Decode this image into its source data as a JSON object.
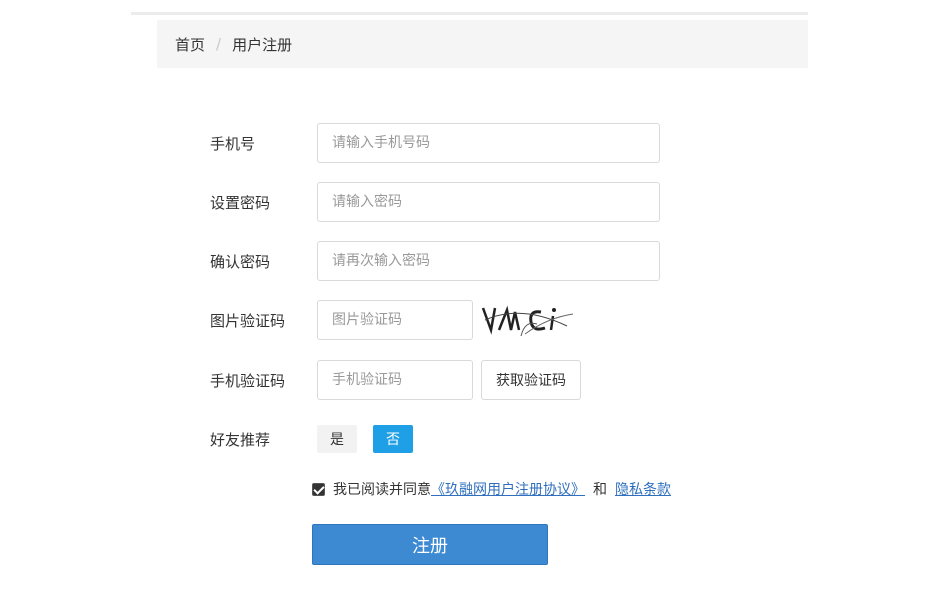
{
  "breadcrumb": {
    "home": "首页",
    "separator": "/",
    "current": "用户注册"
  },
  "form": {
    "phone": {
      "label": "手机号",
      "placeholder": "请输入手机号码"
    },
    "password": {
      "label": "设置密码",
      "placeholder": "请输入密码"
    },
    "confirm_password": {
      "label": "确认密码",
      "placeholder": "请再次输入密码"
    },
    "image_captcha": {
      "label": "图片验证码",
      "placeholder": "图片验证码",
      "captcha_text": "VmCi"
    },
    "sms_code": {
      "label": "手机验证码",
      "placeholder": "手机验证码",
      "button": "获取验证码"
    },
    "referral": {
      "label": "好友推荐",
      "yes": "是",
      "no": "否",
      "selected": "否"
    }
  },
  "agreement": {
    "checked": true,
    "text": "我已阅读并同意",
    "terms_link": "《玖融网用户注册协议》",
    "and": "和",
    "privacy_link": "隐私条款"
  },
  "submit_label": "注册",
  "colors": {
    "primary_button": "#3d8ad3",
    "toggle_active": "#1e9fe6",
    "link": "#2f6fbd"
  }
}
